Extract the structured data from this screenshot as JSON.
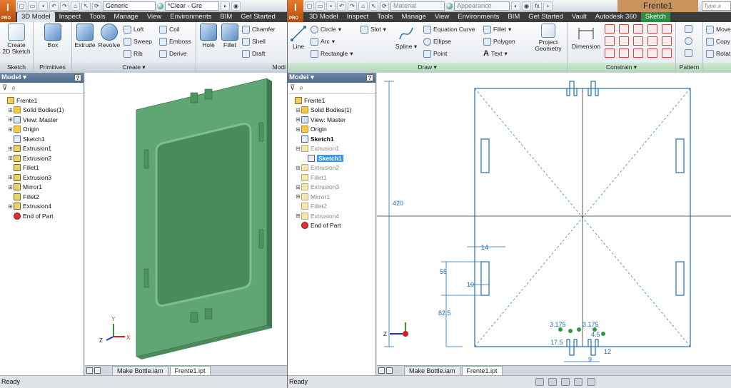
{
  "left": {
    "logo": {
      "main": "I",
      "sub": "PRO"
    },
    "qat": {
      "material": "Generic",
      "appearance": "*Clear - Gre"
    },
    "tabs": [
      {
        "label": "3D Model",
        "active": true
      },
      {
        "label": "Inspect"
      },
      {
        "label": "Tools"
      },
      {
        "label": "Manage"
      },
      {
        "label": "View"
      },
      {
        "label": "Environments"
      },
      {
        "label": "BIM"
      },
      {
        "label": "Get Started"
      }
    ],
    "ribbon": {
      "sketch_panel": {
        "label": "Sketch",
        "create_2d_sketch": "Create\n2D Sketch"
      },
      "primitives_panel": {
        "label": "Primitives",
        "box": "Box"
      },
      "create_panel": {
        "label": "Create",
        "extrude": "Extrude",
        "revolve": "Revolve",
        "loft": "Loft",
        "sweep": "Sweep",
        "rib": "Rib",
        "coil": "Coil",
        "emboss": "Emboss",
        "derive": "Derive"
      },
      "modify_panel": {
        "label": "Modi",
        "hole": "Hole",
        "fillet": "Fillet",
        "chamfer": "Chamfer",
        "shell": "Shell",
        "draft": "Draft"
      }
    },
    "browser": {
      "title": "Model",
      "nodes": [
        {
          "label": "Frente1",
          "icon": "part",
          "depth": 0,
          "exp": ""
        },
        {
          "label": "Solid Bodies(1)",
          "icon": "folder",
          "depth": 1,
          "exp": "+"
        },
        {
          "label": "View: Master",
          "icon": "view",
          "depth": 1,
          "exp": "+"
        },
        {
          "label": "Origin",
          "icon": "folder",
          "depth": 1,
          "exp": "+"
        },
        {
          "label": "Sketch1",
          "icon": "sketch",
          "depth": 1,
          "exp": ""
        },
        {
          "label": "Extrusion1",
          "icon": "feat",
          "depth": 1,
          "exp": "+"
        },
        {
          "label": "Extrusion2",
          "icon": "feat",
          "depth": 1,
          "exp": "+"
        },
        {
          "label": "Fillet1",
          "icon": "feat",
          "depth": 1,
          "exp": ""
        },
        {
          "label": "Extrusion3",
          "icon": "feat",
          "depth": 1,
          "exp": "+"
        },
        {
          "label": "Mirror1",
          "icon": "feat",
          "depth": 1,
          "exp": "+"
        },
        {
          "label": "Fillet2",
          "icon": "feat",
          "depth": 1,
          "exp": ""
        },
        {
          "label": "Extrusion4",
          "icon": "feat",
          "depth": 1,
          "exp": "+"
        },
        {
          "label": "End of Part",
          "icon": "end",
          "depth": 1,
          "exp": ""
        }
      ]
    },
    "doc_tabs": [
      "Make Bottle.iam",
      "Frente1.ipt"
    ],
    "status": "Ready",
    "triad": {
      "x": "X",
      "y": "Y",
      "z": "Z"
    }
  },
  "right": {
    "qat": {
      "material": "Material",
      "appearance": "Appearance",
      "fx": "fx"
    },
    "title": "Frente1",
    "help_placeholder": "Type a key",
    "tabs": [
      {
        "label": "3D Model"
      },
      {
        "label": "Inspect"
      },
      {
        "label": "Tools"
      },
      {
        "label": "Manage"
      },
      {
        "label": "View"
      },
      {
        "label": "Environments"
      },
      {
        "label": "BIM"
      },
      {
        "label": "Get Started"
      },
      {
        "label": "Vault"
      },
      {
        "label": "Autodesk 360"
      },
      {
        "label": "Sketch",
        "green": true
      }
    ],
    "ribbon": {
      "draw_panel": {
        "label": "Draw",
        "line": "Line",
        "circle": "Circle",
        "arc": "Arc",
        "rectangle": "Rectangle",
        "slot": "Slot",
        "spline": "Spline",
        "equation_curve": "Equation Curve",
        "ellipse": "Ellipse",
        "point": "Point",
        "fillet": "Fillet",
        "polygon": "Polygon",
        "text": "Text",
        "project_geometry": "Project\nGeometry"
      },
      "constrain_panel": {
        "label": "Constrain",
        "dimension": "Dimension"
      },
      "pattern_panel": {
        "label": "Pattern"
      },
      "modify_panel": {
        "move": "Move",
        "copy": "Copy",
        "rotate": "Rotat"
      }
    },
    "browser": {
      "title": "Model",
      "nodes": [
        {
          "label": "Frente1",
          "icon": "part",
          "depth": 0,
          "exp": "",
          "style": ""
        },
        {
          "label": "Solid Bodies(1)",
          "icon": "folder",
          "depth": 1,
          "exp": "+",
          "style": ""
        },
        {
          "label": "View: Master",
          "icon": "view",
          "depth": 1,
          "exp": "+",
          "style": ""
        },
        {
          "label": "Origin",
          "icon": "folder",
          "depth": 1,
          "exp": "+",
          "style": ""
        },
        {
          "label": "Sketch1",
          "icon": "sketch",
          "depth": 1,
          "exp": "",
          "style": "bold"
        },
        {
          "label": "Extrusion1",
          "icon": "feat",
          "depth": 1,
          "exp": "-",
          "style": "dim"
        },
        {
          "label": "Sketch1",
          "icon": "sketch",
          "depth": 2,
          "exp": "",
          "style": "hl"
        },
        {
          "label": "Extrusion2",
          "icon": "feat",
          "depth": 1,
          "exp": "+",
          "style": "dim"
        },
        {
          "label": "Fillet1",
          "icon": "feat",
          "depth": 1,
          "exp": "",
          "style": "dim"
        },
        {
          "label": "Extrusion3",
          "icon": "feat",
          "depth": 1,
          "exp": "+",
          "style": "dim"
        },
        {
          "label": "Mirror1",
          "icon": "feat",
          "depth": 1,
          "exp": "+",
          "style": "dim"
        },
        {
          "label": "Fillet2",
          "icon": "feat",
          "depth": 1,
          "exp": "",
          "style": "dim"
        },
        {
          "label": "Extrusion4",
          "icon": "feat",
          "depth": 1,
          "exp": "+",
          "style": "dim"
        },
        {
          "label": "End of Part",
          "icon": "end",
          "depth": 1,
          "exp": "",
          "style": ""
        }
      ]
    },
    "dimensions": {
      "height": "420",
      "slot_width": "14",
      "slot_length": "55",
      "slot_inner": "10",
      "slot_offset": "82.5",
      "d1": "3.175",
      "d2": "3.175",
      "d3": "17.5",
      "d4": "4.5",
      "d5": "12",
      "d6": "9"
    },
    "doc_tabs": [
      "Make Bottle.iam",
      "Frente1.ipt"
    ],
    "status": "Ready",
    "triad": {
      "z": "Z"
    }
  },
  "colors": {
    "model_green": "#5a9d6e",
    "sketch_blue": "#1f6fb4",
    "sketch_tab": "#2e8b43"
  }
}
